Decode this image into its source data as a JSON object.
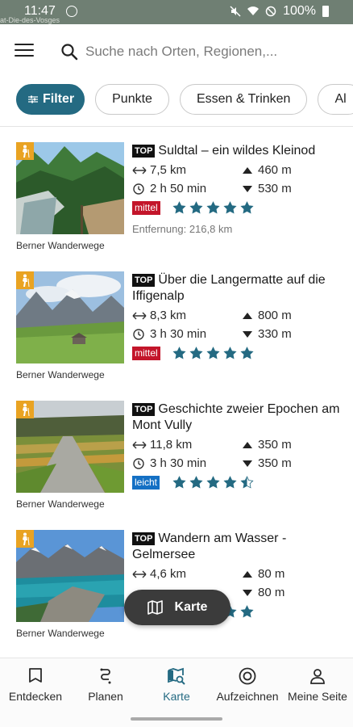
{
  "status_bar": {
    "time": "11:47",
    "battery": "100%",
    "map_label": "at-Die-des-Vosges"
  },
  "search": {
    "placeholder": "Suche nach Orten, Regionen,..."
  },
  "chips": [
    {
      "label": "Filter"
    },
    {
      "label": "Punkte"
    },
    {
      "label": "Essen & Trinken"
    },
    {
      "label": "Al"
    }
  ],
  "tours": [
    {
      "top": "TOP",
      "title": "Suldtal – ein wildes Kleinod",
      "distance": "7,5 km",
      "ascent": "460 m",
      "duration": "2 h 50 min",
      "descent": "530 m",
      "difficulty": "mittel",
      "rating": 5,
      "remoteness": "Entfernung: 216,8 km",
      "author": "Berner Wanderwege",
      "icon": "hiking-icon"
    },
    {
      "top": "TOP",
      "title": "Über die Langermatte auf die Iffigenalp",
      "distance": "8,3 km",
      "ascent": "800 m",
      "duration": "3 h 30 min",
      "descent": "330 m",
      "difficulty": "mittel",
      "rating": 5,
      "remoteness": "",
      "author": "Berner Wanderwege",
      "icon": "hiking-icon"
    },
    {
      "top": "TOP",
      "title": "Geschichte zweier Epochen am Mont Vully",
      "distance": "11,8 km",
      "ascent": "350 m",
      "duration": "3 h 30 min",
      "descent": "350 m",
      "difficulty": "leicht",
      "rating": 4.5,
      "remoteness": "",
      "author": "Berner Wanderwege",
      "icon": "hiking-icon"
    },
    {
      "top": "TOP",
      "title": "Wandern am Wasser - Gelmersee",
      "distance": "4,6 km",
      "ascent": "80 m",
      "duration": "",
      "descent": "80 m",
      "difficulty": "",
      "rating": 5,
      "remoteness": "",
      "author": "Berner Wanderwege",
      "icon": "hiking-icon"
    }
  ],
  "map_button": {
    "label": "Karte"
  },
  "bottom_nav": [
    {
      "label": "Entdecken",
      "icon": "bookmark-icon"
    },
    {
      "label": "Planen",
      "icon": "route-icon"
    },
    {
      "label": "Karte",
      "icon": "map-search-icon",
      "active": true
    },
    {
      "label": "Aufzeichnen",
      "icon": "record-icon"
    },
    {
      "label": "Meine Seite",
      "icon": "person-icon"
    }
  ],
  "colors": {
    "accent": "#246a82",
    "medium": "#c3152a",
    "easy": "#1470c4",
    "hiking_badge": "#e9a322"
  }
}
